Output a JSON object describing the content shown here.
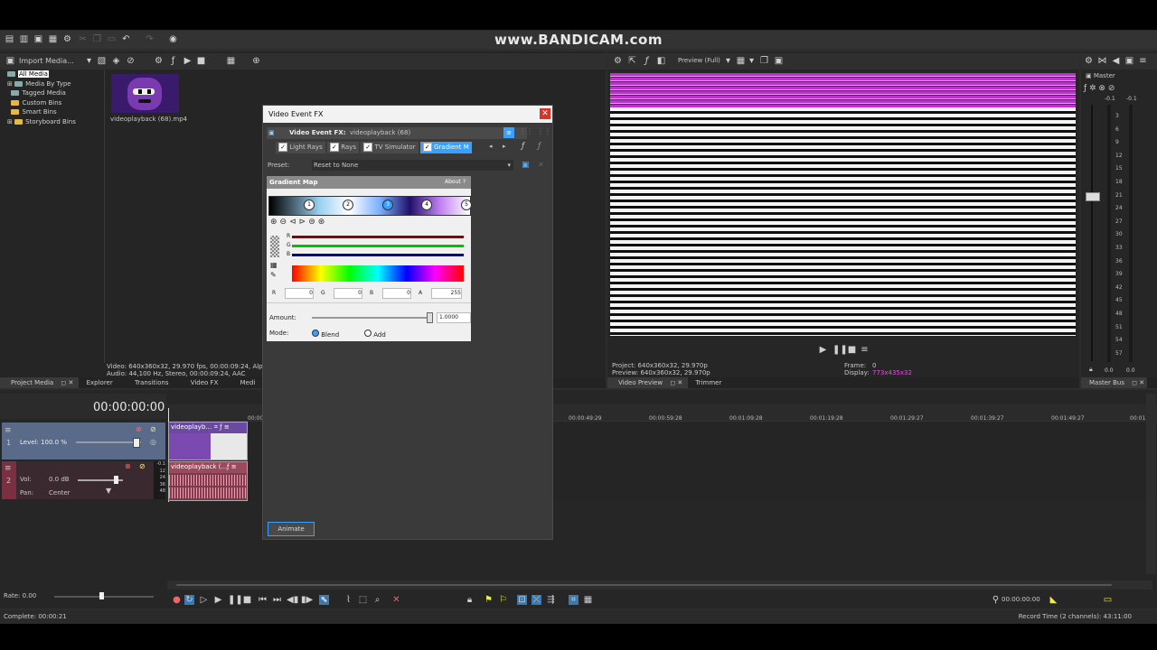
{
  "watermark": "www.BANDICAM.com",
  "colors": {
    "accent": "#3aa0ff",
    "video_track": "#5a6b8a",
    "audio_track": "#7a3040",
    "clip_video": "#6a4aa0",
    "clip_audio": "#9a4a5a",
    "magenta": "#c030d0"
  },
  "media_tree": {
    "items": [
      "All Media",
      "Media By Type",
      "Tagged Media",
      "Custom Bins",
      "Smart Bins",
      "Storyboard Bins"
    ]
  },
  "media": {
    "toolbar_import": "Import Media...",
    "thumb_label": "videoplayback (68).mp4",
    "info_video": "Video: 640x360x32, 29.970 fps, 00:00:09:24, Alpha",
    "info_audio": "Audio: 44,100 Hz, Stereo, 00:00:09:24, AAC"
  },
  "tabs_left": [
    "Project Media",
    "Explorer",
    "Transitions",
    "Video FX",
    "Medi"
  ],
  "preview": {
    "toolbar_label": "Preview (Full)",
    "project": "Project:  640x360x32, 29.970p",
    "preview": "Preview:  640x360x32, 29.970p",
    "frame_label": "Frame:",
    "frame_value": "0",
    "display_label": "Display:",
    "display_value": "773x435x32",
    "tabs": [
      "Video Preview",
      "Trimmer"
    ]
  },
  "mixer": {
    "title": "Master",
    "level_l": "-0.1",
    "level_r": "-0.1",
    "scale": [
      "3",
      "6",
      "9",
      "12",
      "15",
      "18",
      "21",
      "24",
      "27",
      "30",
      "33",
      "36",
      "39",
      "42",
      "45",
      "48",
      "51",
      "54",
      "57"
    ],
    "bottom_l": "0.0",
    "bottom_r": "0.0",
    "tab": "Master Bus"
  },
  "dialog": {
    "title": "Video Event FX",
    "fx_label": "Video Event FX:",
    "fx_clip": "videoplayback (68)",
    "chain": [
      "Light Rays",
      "Rays",
      "TV Simulator",
      "Gradient M"
    ],
    "preset_label": "Preset:",
    "preset_value": "Reset to None",
    "plugin_title": "Gradient Map",
    "about": "About",
    "about_q": "?",
    "stops": [
      "1",
      "2",
      "3",
      "4",
      "5"
    ],
    "channels": [
      "R",
      "G",
      "B"
    ],
    "rgba": {
      "r_label": "R",
      "r": "0",
      "g_label": "G",
      "g": "0",
      "b_label": "B",
      "b": "0",
      "a_label": "A",
      "a": "255"
    },
    "amount_label": "Amount:",
    "amount_value": "1.0000",
    "amount_level": 0.97,
    "mode_label": "Mode:",
    "mode_blend": "Blend",
    "mode_add": "Add",
    "animate": "Animate"
  },
  "timeline": {
    "timecode": "00:00:00:00",
    "ruler": [
      "00:00",
      "00:00:49:29",
      "00:00:59:28",
      "00:01:09:28",
      "00:01:19:28",
      "00:01:29:27",
      "00:01:39:27",
      "00:01:49:27",
      "00:01:5"
    ],
    "video_track": {
      "number": "1",
      "level": "Level: 100.0 %",
      "clip": "videoplayb..."
    },
    "audio_track": {
      "number": "2",
      "vol_label": "Vol:",
      "vol": "0.0 dB",
      "pan_label": "Pan:",
      "pan": "Center",
      "clip": "videoplayback (...",
      "meter": [
        "-0.1",
        "12",
        "24",
        "36",
        "48"
      ]
    },
    "rate": "Rate: 0.00",
    "end_time": "00:00:00:00"
  },
  "status": {
    "left": "Complete: 00:00:21",
    "right": "Record Time (2 channels): 43:11:00"
  }
}
